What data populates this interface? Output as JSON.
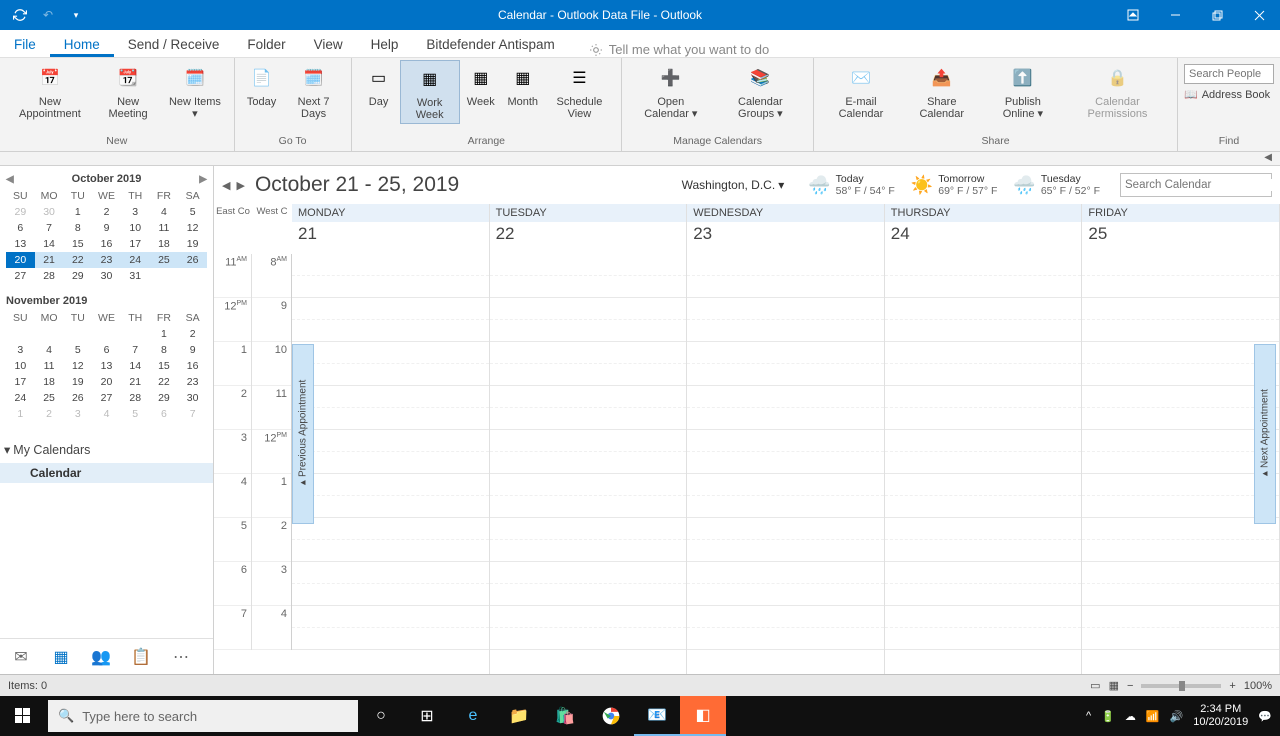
{
  "titlebar": {
    "title": "Calendar - Outlook Data File  -  Outlook"
  },
  "menu": {
    "file": "File",
    "home": "Home",
    "send_receive": "Send / Receive",
    "folder": "Folder",
    "view": "View",
    "help": "Help",
    "bitdefender": "Bitdefender Antispam",
    "tell_me": "Tell me what you want to do"
  },
  "ribbon": {
    "new_appt": "New\nAppointment",
    "new_mtg": "New\nMeeting",
    "new_items": "New\nItems ▾",
    "group_new": "New",
    "today": "Today",
    "next7": "Next\n7 Days",
    "group_goto": "Go To",
    "day": "Day",
    "work_week": "Work\nWeek",
    "week": "Week",
    "month": "Month",
    "sched": "Schedule\nView",
    "group_arrange": "Arrange",
    "open_cal": "Open\nCalendar ▾",
    "cal_groups": "Calendar\nGroups ▾",
    "group_manage": "Manage Calendars",
    "email_cal": "E-mail\nCalendar",
    "share_cal": "Share\nCalendar",
    "publish": "Publish\nOnline ▾",
    "perms": "Calendar\nPermissions",
    "group_share": "Share",
    "search_ppl_ph": "Search People",
    "addr_book": "Address Book",
    "group_find": "Find"
  },
  "mini1": {
    "title": "October 2019",
    "dh": [
      "SU",
      "MO",
      "TU",
      "WE",
      "TH",
      "FR",
      "SA"
    ],
    "rows": [
      [
        "29",
        "30",
        "1",
        "2",
        "3",
        "4",
        "5"
      ],
      [
        "6",
        "7",
        "8",
        "9",
        "10",
        "11",
        "12"
      ],
      [
        "13",
        "14",
        "15",
        "16",
        "17",
        "18",
        "19"
      ],
      [
        "20",
        "21",
        "22",
        "23",
        "24",
        "25",
        "26"
      ],
      [
        "27",
        "28",
        "29",
        "30",
        "31",
        "",
        ""
      ]
    ],
    "today": "20",
    "sel": [
      "21",
      "22",
      "23",
      "24",
      "25",
      "26"
    ]
  },
  "mini2": {
    "title": "November 2019",
    "dh": [
      "SU",
      "MO",
      "TU",
      "WE",
      "TH",
      "FR",
      "SA"
    ],
    "rows": [
      [
        "",
        "",
        "",
        "",
        "",
        "1",
        "2"
      ],
      [
        "3",
        "4",
        "5",
        "6",
        "7",
        "8",
        "9"
      ],
      [
        "10",
        "11",
        "12",
        "13",
        "14",
        "15",
        "16"
      ],
      [
        "17",
        "18",
        "19",
        "20",
        "21",
        "22",
        "23"
      ],
      [
        "24",
        "25",
        "26",
        "27",
        "28",
        "29",
        "30"
      ],
      [
        "1",
        "2",
        "3",
        "4",
        "5",
        "6",
        "7"
      ]
    ]
  },
  "my_calendars": "My Calendars",
  "calendar_item": "Calendar",
  "range": {
    "title": "October 21 - 25, 2019",
    "loc": "Washington, D.C."
  },
  "weather": [
    {
      "ico": "🌧️",
      "day": "Today",
      "temp": "58° F / 54° F"
    },
    {
      "ico": "☀️",
      "day": "Tomorrow",
      "temp": "69° F / 57° F"
    },
    {
      "ico": "🌧️",
      "day": "Tuesday",
      "temp": "65° F / 52° F"
    }
  ],
  "search_cal_ph": "Search Calendar",
  "tz": {
    "left": "East Co",
    "right": "West C"
  },
  "days": [
    {
      "n": "MONDAY",
      "d": "21"
    },
    {
      "n": "TUESDAY",
      "d": "22"
    },
    {
      "n": "WEDNESDAY",
      "d": "23"
    },
    {
      "n": "THURSDAY",
      "d": "24"
    },
    {
      "n": "FRIDAY",
      "d": "25"
    }
  ],
  "hours_left": [
    "11 AM",
    "12 PM",
    "1",
    "2",
    "3",
    "4",
    "5",
    "6",
    "7"
  ],
  "hours_right": [
    "8 AM",
    "9",
    "10",
    "11",
    "12 PM",
    "1",
    "2",
    "3",
    "4"
  ],
  "prev_appt": "Previous Appointment",
  "next_appt": "Next Appointment",
  "status": {
    "items": "Items: 0",
    "zoom": "100%"
  },
  "taskbar": {
    "search_ph": "Type here to search",
    "time": "2:34 PM",
    "date": "10/20/2019"
  }
}
